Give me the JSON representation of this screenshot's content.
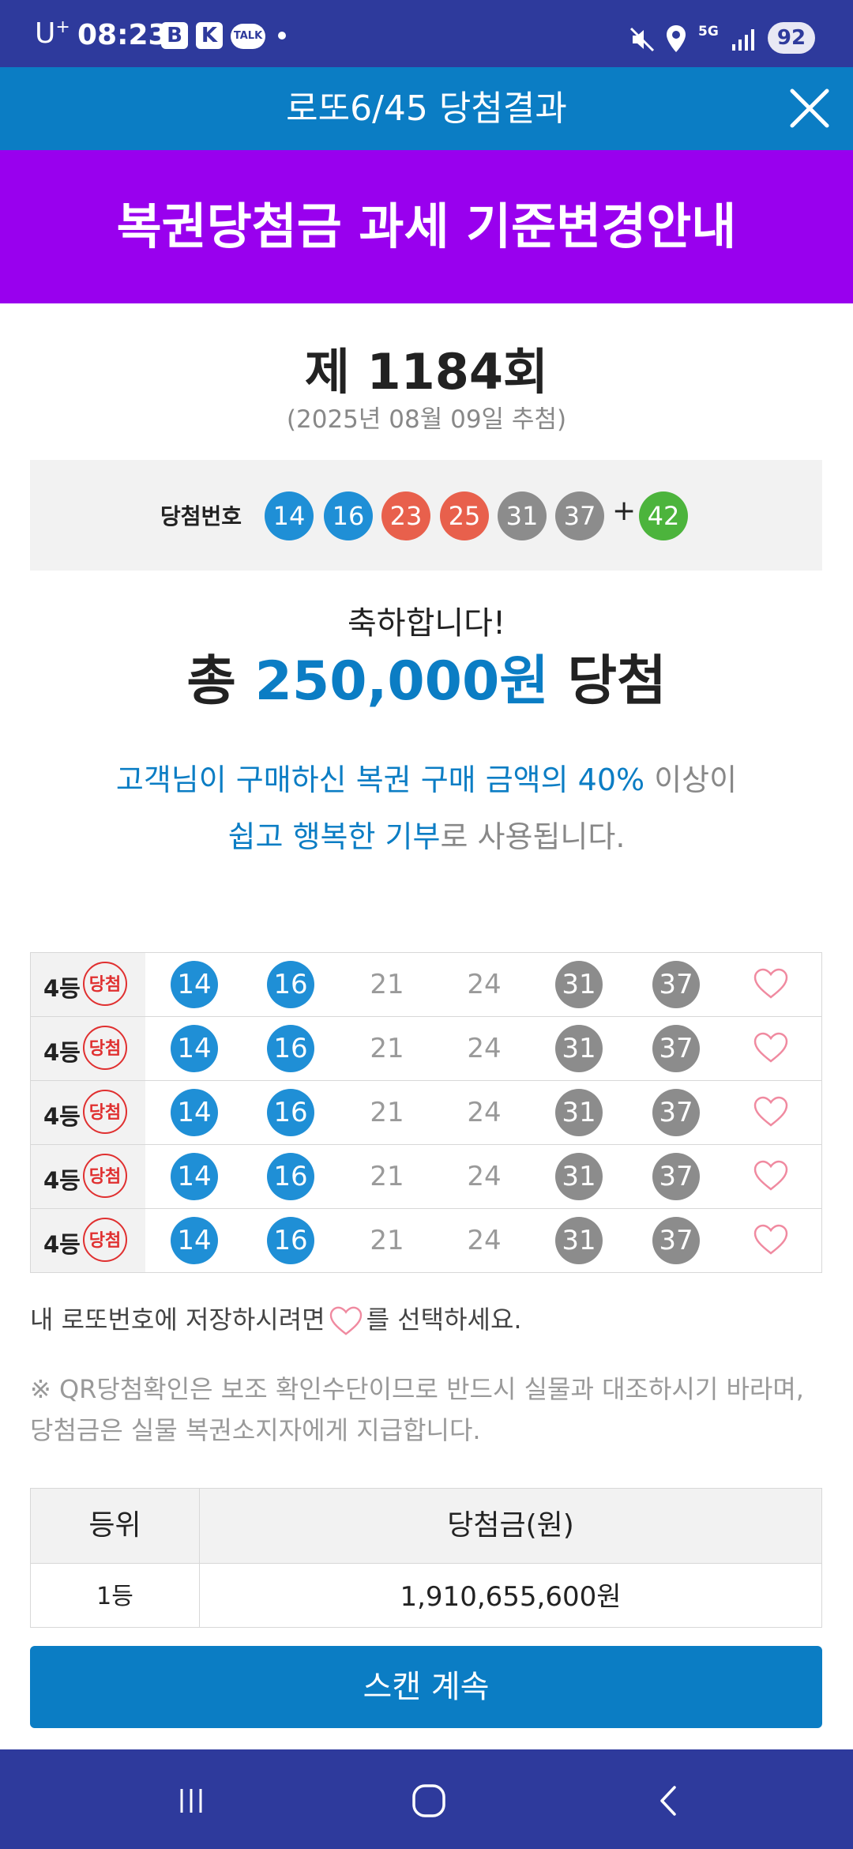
{
  "status_bar": {
    "carrier": "U",
    "carrier_sup": "+",
    "time": "08:23",
    "app_icons": [
      "B",
      "K"
    ],
    "talk": "TALK",
    "network": "5G",
    "battery": "92"
  },
  "header": {
    "title": "로또6/45 당첨결과",
    "close_icon": "close-icon"
  },
  "banner": {
    "text": "복권당첨금 과세 기준변경안내"
  },
  "draw": {
    "title": "제 1184회",
    "date": "(2025년 08월 09일 추첨)",
    "winning_label": "당첨번호",
    "numbers": [
      "14",
      "16",
      "23",
      "25",
      "31",
      "37"
    ],
    "plus": "+",
    "bonus": "42"
  },
  "result": {
    "congrats": "축하합니다!",
    "total_prefix": "총",
    "total_amount": "250,000원",
    "total_suffix": "당첨"
  },
  "donation": {
    "line1_blue": "고객님이 구매하신 복권 구매 금액의 40%",
    "line1_gray": " 이상이",
    "line2_blue": "쉽고 행복한 기부",
    "line2_gray": "로 사용됩니다."
  },
  "ticket_rows": [
    {
      "rank": "4등",
      "stamp": "당첨",
      "numbers": [
        "14",
        "16",
        "21",
        "24",
        "31",
        "37"
      ]
    },
    {
      "rank": "4등",
      "stamp": "당첨",
      "numbers": [
        "14",
        "16",
        "21",
        "24",
        "31",
        "37"
      ]
    },
    {
      "rank": "4등",
      "stamp": "당첨",
      "numbers": [
        "14",
        "16",
        "21",
        "24",
        "31",
        "37"
      ]
    },
    {
      "rank": "4등",
      "stamp": "당첨",
      "numbers": [
        "14",
        "16",
        "21",
        "24",
        "31",
        "37"
      ]
    },
    {
      "rank": "4등",
      "stamp": "당첨",
      "numbers": [
        "14",
        "16",
        "21",
        "24",
        "31",
        "37"
      ]
    }
  ],
  "save_tip": {
    "before": "내 로또번호에 저장하시려면",
    "after": "를 선택하세요."
  },
  "notice": {
    "line1": "※ QR당첨확인은 보조 확인수단이므로 반드시 실물과 대조하시기 바라며,",
    "line2": "당첨금은 실물 복권소지자에게 지급합니다."
  },
  "prize_table": {
    "headers": {
      "rank": "등위",
      "amount": "당첨금(원)"
    },
    "rows": [
      {
        "rank": "1등",
        "amount": "1,910,655,600원"
      }
    ]
  },
  "scan_button": {
    "label": "스캔 계속"
  },
  "colors": {
    "blue_ball": "#1f8fd6",
    "red_ball": "#e8604c",
    "gray_ball": "#8c8c8c",
    "green_ball": "#4cb43c",
    "accent": "#0b7dc4",
    "banner": "#9900ee",
    "status_bar": "#2e3a9c"
  }
}
